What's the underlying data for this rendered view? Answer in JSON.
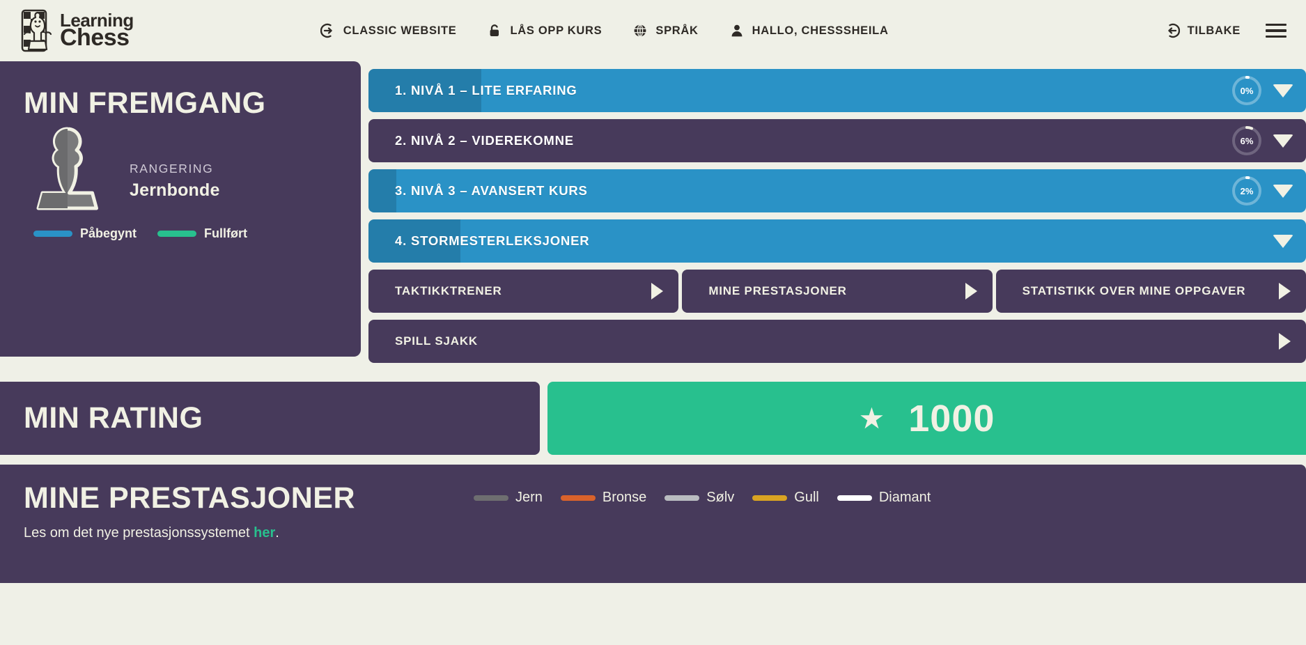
{
  "header": {
    "logo": {
      "line1": "Learning",
      "line2": "Chess",
      "icon": "chess-pawn-logo-icon"
    },
    "nav": [
      {
        "label": "Classic website",
        "icon": "arrow-right-circle-icon"
      },
      {
        "label": "Lås opp kurs",
        "icon": "lock-icon"
      },
      {
        "label": "Språk",
        "icon": "globe-icon"
      },
      {
        "label": "Hallo, Chesssheila",
        "icon": "user-icon"
      }
    ],
    "back": {
      "label": "Tilbake",
      "icon": "arrow-left-circle-icon"
    },
    "menu_icon": "hamburger-menu-icon"
  },
  "progress": {
    "title": "Min fremgang",
    "pawn_icon": "pawn-icon",
    "rank_label": "Rangering",
    "rank_value": "Jernbonde",
    "legend": [
      {
        "label": "Påbegynt",
        "color": "#2a92c6"
      },
      {
        "label": "Fullført",
        "color": "#28c08e"
      }
    ]
  },
  "levels": [
    {
      "label": "1. Nivå 1 – Lite erfaring",
      "percent": "0%",
      "percent_value": 0,
      "fill_pct": 12,
      "bg": "#2a92c6",
      "has_ring": true
    },
    {
      "label": "2. Nivå 2 – Viderekomne",
      "percent": "6%",
      "percent_value": 6,
      "fill_pct": 0,
      "bg": "#473a5b",
      "has_ring": true
    },
    {
      "label": "3. Nivå 3 – Avansert kurs",
      "percent": "2%",
      "percent_value": 2,
      "fill_pct": 3,
      "bg": "#2a92c6",
      "has_ring": true
    },
    {
      "label": "4. Stormesterleksjoner",
      "percent": "",
      "percent_value": 0,
      "fill_pct": 9.8,
      "bg": "#2a92c6",
      "has_ring": false
    }
  ],
  "actions": {
    "row1": [
      {
        "label": "Taktikktrener"
      },
      {
        "label": "Mine prestasjoner"
      },
      {
        "label": "Statistikk over mine oppgaver"
      }
    ],
    "row2": [
      {
        "label": "Spill sjakk"
      }
    ]
  },
  "rating": {
    "title": "Min rating",
    "star_icon": "star-icon",
    "value": "1000"
  },
  "achievements": {
    "title": "Mine prestasjoner",
    "subtitle_before": "Les om det nye prestasjonssystemet ",
    "subtitle_link": "her",
    "subtitle_after": ".",
    "legend": [
      {
        "label": "Jern",
        "color": "#6e6e70"
      },
      {
        "label": "Bronse",
        "color": "#d9622b"
      },
      {
        "label": "Sølv",
        "color": "#b9bcc0"
      },
      {
        "label": "Gull",
        "color": "#d9a322"
      },
      {
        "label": "Diamant",
        "color": "#ffffff"
      }
    ]
  },
  "colors": {
    "page_bg": "#eff0e7",
    "panel": "#473a5b",
    "blue": "#2a92c6",
    "teal": "#28c08e",
    "cream": "#f1f1e4",
    "ink": "#2e2a26"
  }
}
